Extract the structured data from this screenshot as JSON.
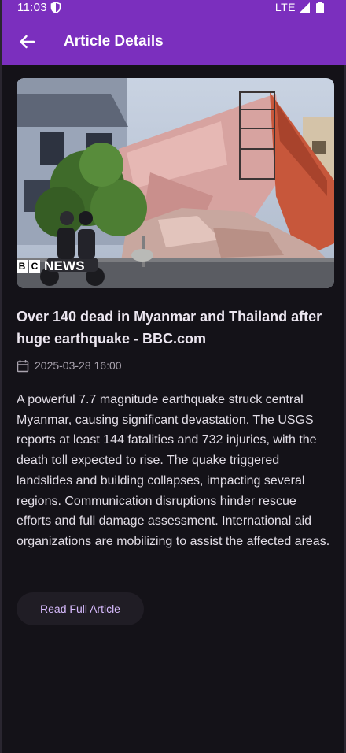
{
  "status_bar": {
    "time": "11:03",
    "network": "LTE",
    "shield_icon": "shield-icon",
    "signal_icon": "signal-icon",
    "battery_icon": "battery-icon"
  },
  "app_bar": {
    "title": "Article Details",
    "back_icon": "arrow-back-icon",
    "background_color": "#7b2fbe"
  },
  "article": {
    "image_logo": {
      "box1": "B",
      "box2": "C",
      "text": "NEWS"
    },
    "headline": "Over 140 dead in Myanmar and Thailand after huge earthquake - BBC.com",
    "date": "2025-03-28 16:00",
    "calendar_icon": "calendar-icon",
    "body": "A powerful 7.7 magnitude earthquake struck central Myanmar, causing significant devastation.  The USGS reports at least 144 fatalities and 732 injuries, with the death toll expected to rise.  The quake triggered landslides and building collapses, impacting several regions.  Communication disruptions hinder rescue efforts and full damage assessment.  International aid organizations are mobilizing to assist the affected areas.",
    "read_button_label": "Read Full Article"
  },
  "colors": {
    "background": "#141218",
    "accent": "#d6bafc",
    "text_primary": "#ece6f0",
    "text_secondary": "#a9a3ae"
  }
}
